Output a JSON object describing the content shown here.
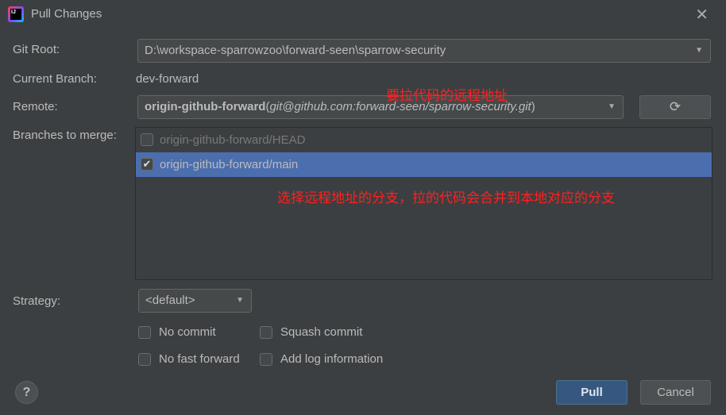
{
  "window": {
    "title": "Pull Changes",
    "close_icon": "close-icon"
  },
  "form": {
    "git_root_label": "Git Root:",
    "git_root_value": "D:\\workspace-sparrowzoo\\forward-seen\\sparrow-security",
    "current_branch_label": "Current Branch:",
    "current_branch_value": "dev-forward",
    "remote_label": "Remote:",
    "remote_name": "origin-github-forward",
    "remote_url": "git@github.com:forward-seen/sparrow-security.git",
    "branches_label": "Branches to merge:",
    "branches": [
      {
        "name": "origin-github-forward/HEAD",
        "checked": false,
        "selected": false
      },
      {
        "name": "origin-github-forward/main",
        "checked": true,
        "selected": true
      }
    ],
    "strategy_label": "Strategy:",
    "strategy_value": "<default>",
    "options": [
      {
        "label": "No commit",
        "checked": false
      },
      {
        "label": "Squash commit",
        "checked": false
      },
      {
        "label": "No fast forward",
        "checked": false
      },
      {
        "label": "Add log information",
        "checked": false
      }
    ]
  },
  "annotations": {
    "remote_note": "要拉代码的远程地址",
    "branch_note": "选择远程地址的分支，拉的代码会合并到本地对应的分支"
  },
  "buttons": {
    "pull": "Pull",
    "cancel": "Cancel",
    "help": "?"
  },
  "colors": {
    "background": "#3c3f41",
    "selection": "#4b6eaf",
    "primary_button": "#365880",
    "annotation": "#ff2020"
  }
}
